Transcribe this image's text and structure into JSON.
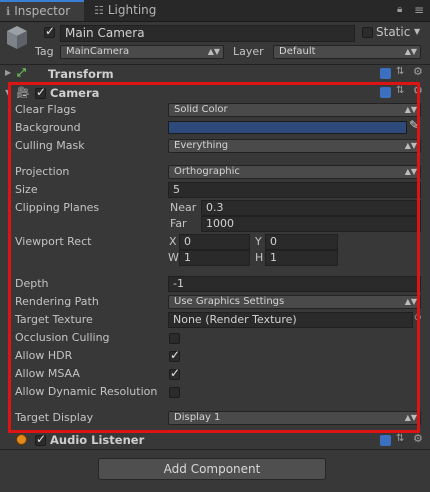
{
  "tabs": [
    {
      "label": "Inspector",
      "icon": "inspector-icon"
    },
    {
      "label": "Lighting",
      "icon": "lighting-icon"
    }
  ],
  "object": {
    "enabled": true,
    "name": "Main Camera",
    "static_label": "Static",
    "tag_label": "Tag",
    "tag_value": "MainCamera",
    "layer_label": "Layer",
    "layer_value": "Default"
  },
  "components": {
    "transform_title": "Transform",
    "camera_title": "Camera",
    "audio_listener_title": "Audio Listener"
  },
  "camera": {
    "clear_flags": {
      "label": "Clear Flags",
      "value": "Solid Color"
    },
    "background": {
      "label": "Background",
      "color": "#2d4a7a"
    },
    "culling_mask": {
      "label": "Culling Mask",
      "value": "Everything"
    },
    "projection": {
      "label": "Projection",
      "value": "Orthographic"
    },
    "size": {
      "label": "Size",
      "value": "5"
    },
    "clipping_planes": {
      "label": "Clipping Planes",
      "near_label": "Near",
      "near": "0.3",
      "far_label": "Far",
      "far": "1000"
    },
    "viewport_rect": {
      "label": "Viewport Rect",
      "x_label": "X",
      "x": "0",
      "y_label": "Y",
      "y": "0",
      "w_label": "W",
      "w": "1",
      "h_label": "H",
      "h": "1"
    },
    "depth": {
      "label": "Depth",
      "value": "-1"
    },
    "rendering_path": {
      "label": "Rendering Path",
      "value": "Use Graphics Settings"
    },
    "target_texture": {
      "label": "Target Texture",
      "value": "None (Render Texture)"
    },
    "occlusion_culling": {
      "label": "Occlusion Culling",
      "checked": false
    },
    "allow_hdr": {
      "label": "Allow HDR",
      "checked": true
    },
    "allow_msaa": {
      "label": "Allow MSAA",
      "checked": true
    },
    "allow_dynamic_resolution": {
      "label": "Allow Dynamic Resolution",
      "checked": false
    },
    "target_display": {
      "label": "Target Display",
      "value": "Display 1"
    }
  },
  "add_component_label": "Add Component",
  "colors": {
    "highlight": "#dd1414",
    "accent": "#3a7fd5",
    "background_swatch": "#2d4a7a"
  }
}
